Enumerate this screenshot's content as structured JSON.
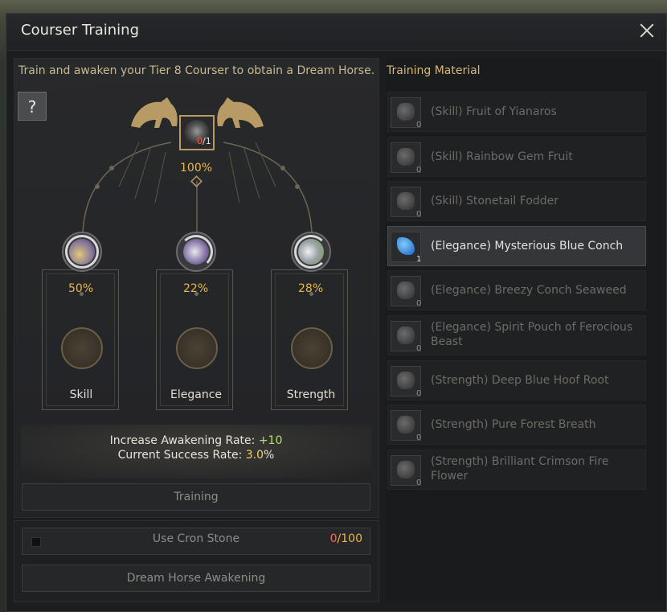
{
  "window": {
    "title": "Courser Training"
  },
  "left": {
    "description": "Train and awaken your Tier 8 Courser to obtain a Dream Horse.",
    "help_label": "?",
    "center_count_current": "0",
    "center_count_total": "/1",
    "center_percent": "100%",
    "columns": [
      {
        "label": "Skill",
        "percent": "50%"
      },
      {
        "label": "Elegance",
        "percent": "22%"
      },
      {
        "label": "Strength",
        "percent": "28%"
      }
    ],
    "info": {
      "awaken_rate_label": "Increase Awakening Rate: ",
      "awaken_rate_value": "+10",
      "success_rate_label": "Current Success Rate: ",
      "success_rate_value": "3.0",
      "success_rate_unit": "%"
    },
    "training_button": "Training",
    "cron_label": "Use Cron Stone",
    "cron_current": "0",
    "cron_total": "/100",
    "awakening_button": "Dream Horse Awakening"
  },
  "right": {
    "title": "Training Material",
    "materials": [
      {
        "name": "(Skill) Fruit of Yianaros",
        "count": "0",
        "selected": false
      },
      {
        "name": "(Skill) Rainbow Gem Fruit",
        "count": "0",
        "selected": false
      },
      {
        "name": "(Skill) Stonetail Fodder",
        "count": "0",
        "selected": false
      },
      {
        "name": "(Elegance) Mysterious Blue Conch",
        "count": "1",
        "selected": true
      },
      {
        "name": "(Elegance) Breezy Conch Seaweed",
        "count": "0",
        "selected": false
      },
      {
        "name_line1": "(Elegance) Spirit Pouch of Ferocious",
        "name_line2": "Beast",
        "count": "0",
        "selected": false
      },
      {
        "name": "(Strength) Deep Blue Hoof Root",
        "count": "0",
        "selected": false
      },
      {
        "name": "(Strength) Pure Forest Breath",
        "count": "0",
        "selected": false
      },
      {
        "name_line1": "(Strength) Brilliant Crimson Fire",
        "name_line2": "Flower",
        "count": "0",
        "selected": false
      }
    ]
  },
  "colors": {
    "accent_gold": "#e8b64a",
    "green": "#b8e060",
    "red": "#ff5a4a"
  }
}
